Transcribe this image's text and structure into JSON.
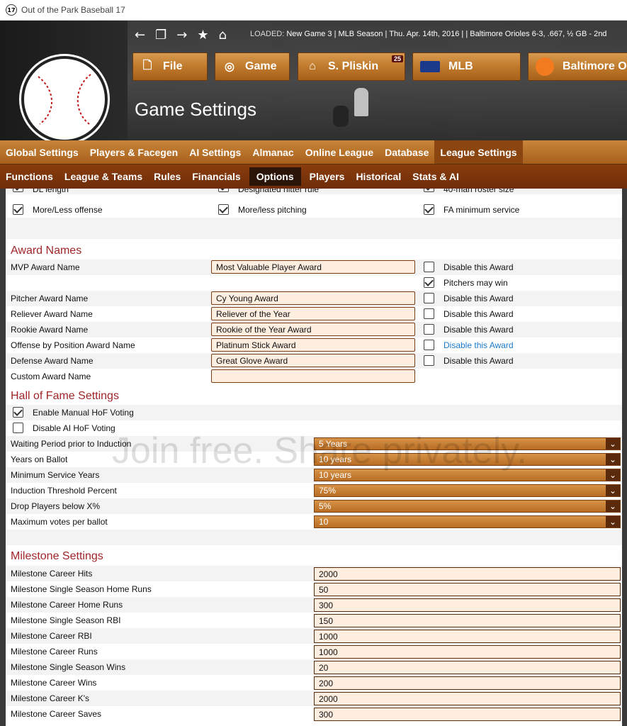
{
  "window": {
    "title": "Out of the Park Baseball 17",
    "icon_text": "17"
  },
  "header": {
    "loaded_label": "LOADED:",
    "loaded_text": "New Game 3 | MLB Season | Thu. Apr. 14th, 2016 | | Baltimore Orioles 6-3, .667, ½ GB - 2nd",
    "buttons": [
      {
        "label": "File",
        "icon": "file-icon"
      },
      {
        "label": "Game",
        "icon": "globe-icon"
      },
      {
        "label": "S. Pliskin",
        "icon": "home-icon",
        "badge": "25"
      },
      {
        "label": "MLB",
        "icon": "mlb-logo"
      },
      {
        "label": "Baltimore O",
        "icon": "orioles-logo"
      }
    ],
    "page_title": "Game Settings"
  },
  "tabs1": [
    "Global Settings",
    "Players & Facegen",
    "AI Settings",
    "Almanac",
    "Online League",
    "Database",
    "League Settings"
  ],
  "tabs1_active": "League Settings",
  "tabs2": [
    "Functions",
    "League & Teams",
    "Rules",
    "Financials",
    "Options",
    "Players",
    "Historical",
    "Stats & AI"
  ],
  "tabs2_active": "Options",
  "options_top": {
    "partial": [
      "DL length",
      "Designated hitter rule",
      "40-man roster size"
    ],
    "row": [
      "More/Less offense",
      "More/less pitching",
      "FA minimum service"
    ]
  },
  "awards": {
    "title": "Award Names",
    "rows": [
      {
        "label": "MVP Award Name",
        "value": "Most Valuable Player Award",
        "disable": "Disable this Award"
      },
      {
        "label": "Pitcher Award Name",
        "value": "Cy Young Award",
        "disable": "Disable this Award"
      },
      {
        "label": "Reliever Award Name",
        "value": "Reliever of the Year",
        "disable": "Disable this Award"
      },
      {
        "label": "Rookie Award Name",
        "value": "Rookie of the Year Award",
        "disable": "Disable this Award"
      },
      {
        "label": "Offense by Position Award Name",
        "value": "Platinum Stick Award",
        "disable": "Disable this Award"
      },
      {
        "label": "Defense Award Name",
        "value": "Great Glove Award",
        "disable": "Disable this Award"
      },
      {
        "label": "Custom Award Name",
        "value": ""
      }
    ],
    "pitchers_may_win": "Pitchers may win"
  },
  "hof": {
    "title": "Hall of Fame Settings",
    "manual": "Enable Manual HoF Voting",
    "disable_ai": "Disable AI HoF Voting",
    "rows": [
      {
        "label": "Waiting Period prior to Induction",
        "value": "5 Years"
      },
      {
        "label": "Years on Ballot",
        "value": "10 years"
      },
      {
        "label": "Minimum Service Years",
        "value": "10 years"
      },
      {
        "label": "Induction Threshold Percent",
        "value": "75%"
      },
      {
        "label": "Drop Players below X%",
        "value": "5%"
      },
      {
        "label": "Maximum votes per ballot",
        "value": "10"
      }
    ]
  },
  "milestones": {
    "title": "Milestone Settings",
    "rows": [
      {
        "label": "Milestone Career Hits",
        "value": "2000"
      },
      {
        "label": "Milestone Single Season Home Runs",
        "value": "50"
      },
      {
        "label": "Milestone Career Home Runs",
        "value": "300"
      },
      {
        "label": "Milestone Single Season RBI",
        "value": "150"
      },
      {
        "label": "Milestone Career RBI",
        "value": "1000"
      },
      {
        "label": "Milestone Career Runs",
        "value": "1000"
      },
      {
        "label": "Milestone Single Season Wins",
        "value": "20"
      },
      {
        "label": "Milestone Career Wins",
        "value": "200"
      },
      {
        "label": "Milestone Career K's",
        "value": "2000"
      },
      {
        "label": "Milestone Career Saves",
        "value": "300"
      }
    ]
  },
  "watermark": "Join free. Share privately.",
  "colors": {
    "section_title": "#a0262a",
    "link": "#1a7acb",
    "accent": "#c07a2c"
  }
}
